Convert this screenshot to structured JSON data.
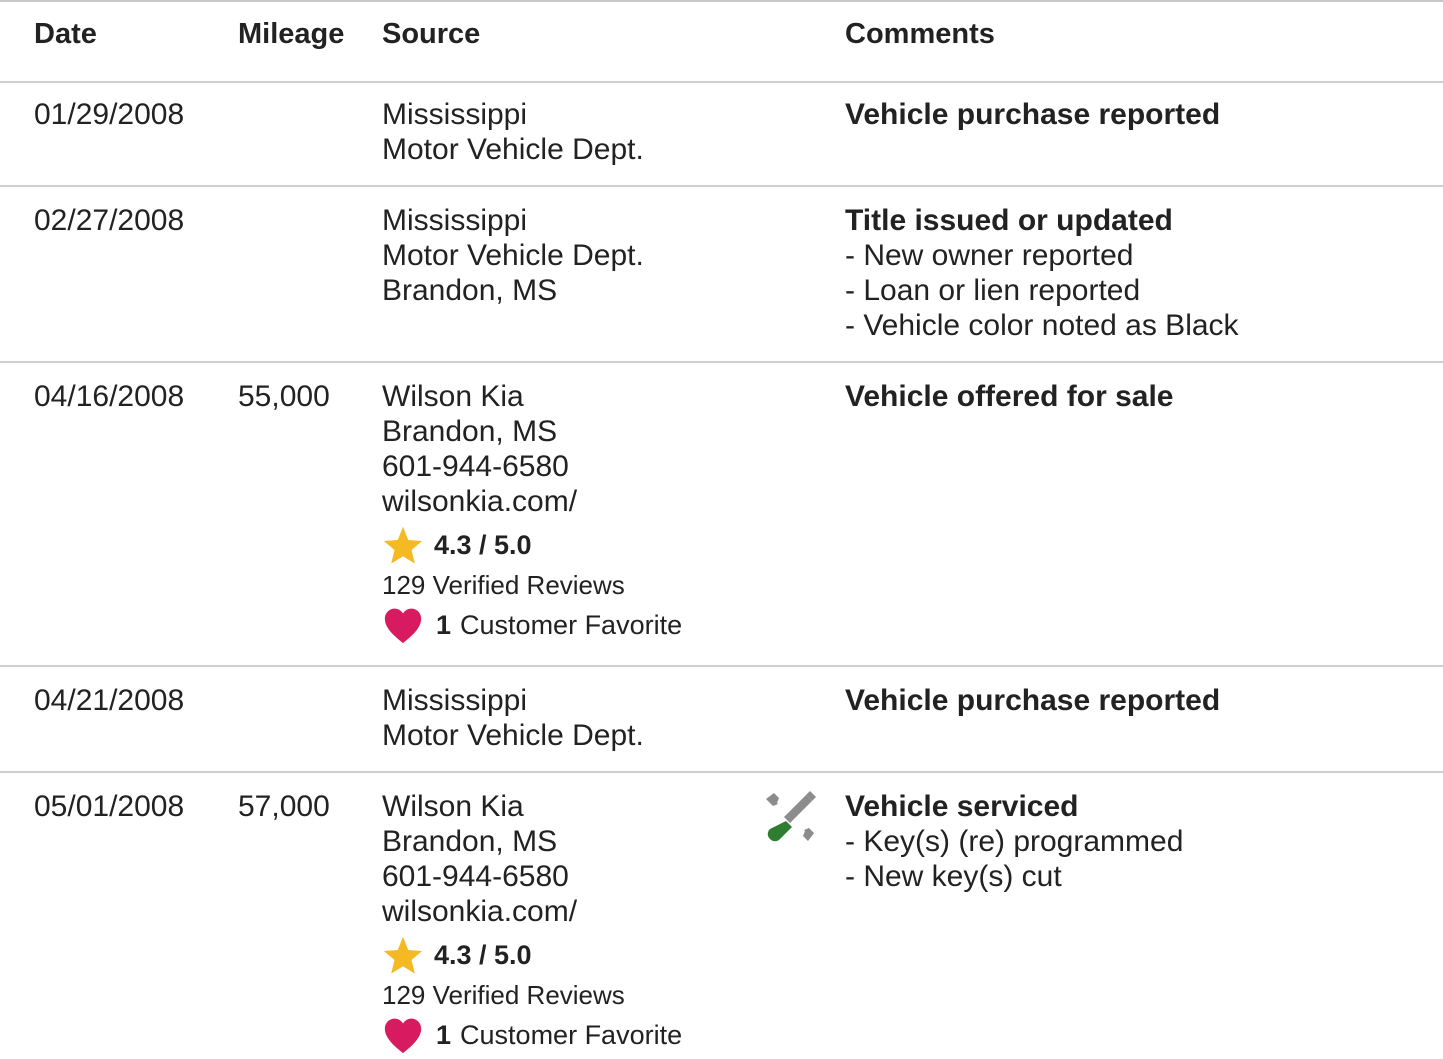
{
  "headers": {
    "date": "Date",
    "mileage": "Mileage",
    "source": "Source",
    "comments": "Comments"
  },
  "colors": {
    "star": "#f4b923",
    "heart": "#d81b60",
    "wrench": "#8c8c8c",
    "screwdriver_handle": "#2e7d32",
    "divider": "#cfcfcf"
  },
  "rows": [
    {
      "date": "01/29/2008",
      "mileage": "",
      "source": [
        "Mississippi",
        "Motor Vehicle Dept."
      ],
      "comment_title": "Vehicle purchase reported",
      "comment_items": []
    },
    {
      "date": "02/27/2008",
      "mileage": "",
      "source": [
        "Mississippi",
        "Motor Vehicle Dept.",
        "Brandon, MS"
      ],
      "comment_title": "Title issued or updated",
      "comment_items": [
        "- New owner reported",
        "- Loan or lien reported",
        "- Vehicle color noted as Black"
      ]
    },
    {
      "date": "04/16/2008",
      "mileage": "55,000",
      "source": [
        "Wilson Kia",
        "Brandon, MS",
        "601-944-6580",
        "wilsonkia.com/"
      ],
      "rating": "4.3 / 5.0",
      "reviews": "129 Verified Reviews",
      "favorite_count": "1",
      "favorite_label": "Customer Favorite",
      "comment_title": "Vehicle offered for sale",
      "comment_items": []
    },
    {
      "date": "04/21/2008",
      "mileage": "",
      "source": [
        "Mississippi",
        "Motor Vehicle Dept."
      ],
      "comment_title": "Vehicle purchase reported",
      "comment_items": []
    },
    {
      "date": "05/01/2008",
      "mileage": "57,000",
      "source": [
        "Wilson Kia",
        "Brandon, MS",
        "601-944-6580",
        "wilsonkia.com/"
      ],
      "rating": "4.3 / 5.0",
      "reviews": "129 Verified Reviews",
      "favorite_count": "1",
      "favorite_label": "Customer Favorite",
      "icon": "service-tools-icon",
      "comment_title": "Vehicle serviced",
      "comment_items": [
        "- Key(s) (re) programmed",
        "- New key(s) cut"
      ]
    }
  ]
}
